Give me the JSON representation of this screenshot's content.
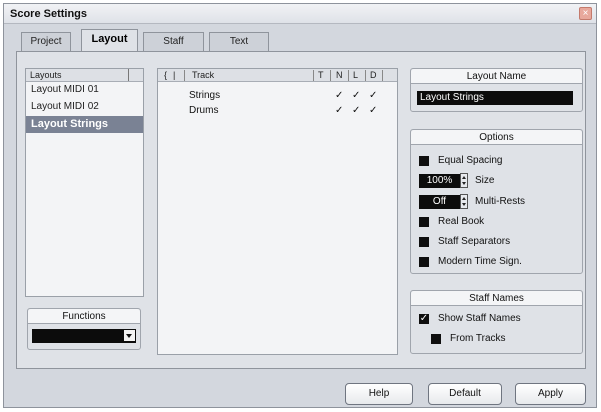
{
  "window": {
    "title": "Score Settings",
    "close_glyph": "×"
  },
  "tabs": [
    {
      "label": "Project",
      "active": false
    },
    {
      "label": "Layout",
      "active": true
    },
    {
      "label": "Staff",
      "active": false
    },
    {
      "label": "Text",
      "active": false
    }
  ],
  "layouts": {
    "header": "Layouts",
    "items": [
      "Layout MIDI 01",
      "Layout MIDI 02",
      "Layout Strings"
    ],
    "selected_index": 2
  },
  "functions": {
    "title": "Functions",
    "value": ""
  },
  "tracks": {
    "columns": {
      "bracket": "{",
      "bar": "|",
      "name": "Track",
      "t": "T",
      "n": "N",
      "l": "L",
      "d": "D"
    },
    "rows": [
      {
        "name": "Strings",
        "t": "",
        "n": "✓",
        "l": "✓",
        "d": "✓"
      },
      {
        "name": "Drums",
        "t": "",
        "n": "✓",
        "l": "✓",
        "d": "✓"
      }
    ]
  },
  "layout_name": {
    "title": "Layout Name",
    "value": "Layout Strings"
  },
  "options": {
    "title": "Options",
    "equal_spacing": "Equal Spacing",
    "size_value": "100%",
    "size_label": "Size",
    "multi_rests_value": "Off",
    "multi_rests_label": "Multi-Rests",
    "real_book": "Real Book",
    "staff_separators": "Staff Separators",
    "modern_time_sign": "Modern Time Sign."
  },
  "staff_names": {
    "title": "Staff Names",
    "show_staff_names": "Show Staff Names",
    "show_staff_names_checked": true,
    "from_tracks": "From Tracks",
    "check_glyph": "✓"
  },
  "buttons": {
    "help": "Help",
    "default": "Default",
    "apply": "Apply"
  },
  "icons": {
    "dropdown": "dropdown-arrow-icon"
  }
}
